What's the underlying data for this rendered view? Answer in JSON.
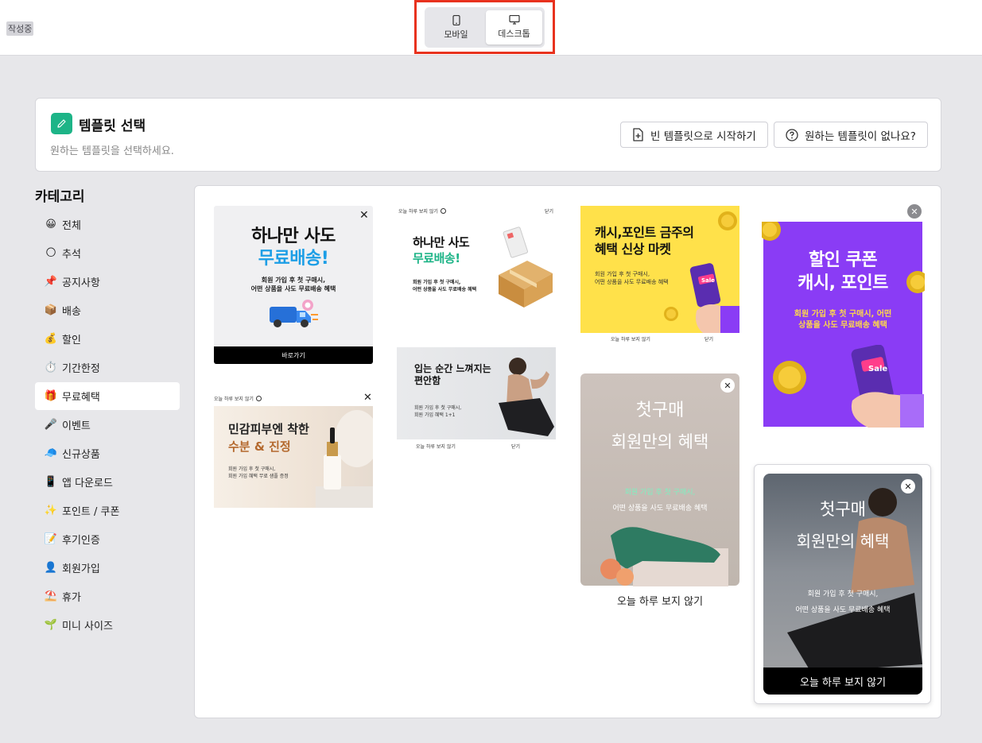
{
  "status_badge": "작성중",
  "device_toggle": {
    "mobile_label": "모바일",
    "desktop_label": "데스크톱"
  },
  "header": {
    "title": "템플릿 선택",
    "subtitle": "원하는 템플릿을 선택하세요.",
    "blank_button": "빈 템플릿으로 시작하기",
    "help_button": "원하는 템플릿이 없나요?"
  },
  "categories": {
    "title": "카테고리",
    "items": [
      {
        "emoji": "😀",
        "label": "전체"
      },
      {
        "emoji": "🌕",
        "label": "추석"
      },
      {
        "emoji": "📌",
        "label": "공지사항"
      },
      {
        "emoji": "📦",
        "label": "배송"
      },
      {
        "emoji": "💰",
        "label": "할인"
      },
      {
        "emoji": "⏱️",
        "label": "기간한정"
      },
      {
        "emoji": "🎁",
        "label": "무료혜택"
      },
      {
        "emoji": "🎤",
        "label": "이벤트"
      },
      {
        "emoji": "🧢",
        "label": "신규상품"
      },
      {
        "emoji": "📱",
        "label": "앱 다운로드"
      },
      {
        "emoji": "✨",
        "label": "포인트 / 쿠폰"
      },
      {
        "emoji": "📝",
        "label": "후기인증"
      },
      {
        "emoji": "👤",
        "label": "회원가입"
      },
      {
        "emoji": "⛱️",
        "label": "휴가"
      },
      {
        "emoji": "🌱",
        "label": "미니 사이즈"
      }
    ]
  },
  "templates": {
    "t1": {
      "line1": "하나만 사도",
      "line2": "무료배송!",
      "sub1": "회원 가입 후 첫 구매시,",
      "sub2": "어떤 상품을 사도 무료배송 혜택",
      "button": "바로가기"
    },
    "t2": {
      "top_left": "오늘 하루 보지 않기",
      "top_right": "닫기",
      "line1": "하나만 사도",
      "line2": "무료배송!",
      "sub": "회원 가입 후 첫 구매시,",
      "sub2": "어떤 상품을 사도 무료배송 혜택"
    },
    "t3": {
      "line1": "캐시,포인트 금주의",
      "line2": "혜택 신상 마켓",
      "sub1": "회원 가입 후 첫 구매시,",
      "sub2": "어떤 상품을 사도 무료배송 혜택",
      "badge": "Sale",
      "footer_left": "오늘 하루 보지 않기",
      "footer_right": "닫기"
    },
    "t4": {
      "line1": "할인 쿠폰",
      "line2": "캐시, 포인트",
      "sub1": "회원 가입 후 첫 구매시, 어떤",
      "sub2": "상품을 사도 무료배송 혜택",
      "badge": "Sale"
    },
    "t5": {
      "top_left": "오늘 하루 보지 않기",
      "line1": "민감피부엔 착한",
      "line2": "수분 & 진정",
      "sub1": "회원 가입 후 첫 구매시,",
      "sub2": "회원 가입 혜택 무료 샘플 증정"
    },
    "t6": {
      "line1": "입는 순간 느껴지는",
      "line2": "편안함",
      "sub1": "회원 가입 후 첫 구매시,",
      "sub2": "회원 가입 혜택 1+1",
      "footer_left": "오늘 하루 보지 않기",
      "footer_right": "닫기"
    },
    "t7": {
      "line1": "첫구매",
      "line2": "회원만의 혜택",
      "sub1": "회원 가입 후 첫 구매시,",
      "sub2": "어떤 상품을 사도 무료배송 혜택",
      "footer": "오늘 하루 보지 않기"
    },
    "t8": {
      "line1": "첫구매",
      "line2": "회원만의 혜택",
      "sub1": "회원 가입 후 첫 구매시,",
      "sub2": "어떤 상품을 사도 무료배송 혜택",
      "footer": "오늘 하루 보지 않기"
    }
  },
  "colors": {
    "accent_green": "#1db487",
    "highlight_red": "#e8321e",
    "yellow": "#ffe14a",
    "purple": "#8a3cf5",
    "sky_blue": "#1c9ee6"
  }
}
